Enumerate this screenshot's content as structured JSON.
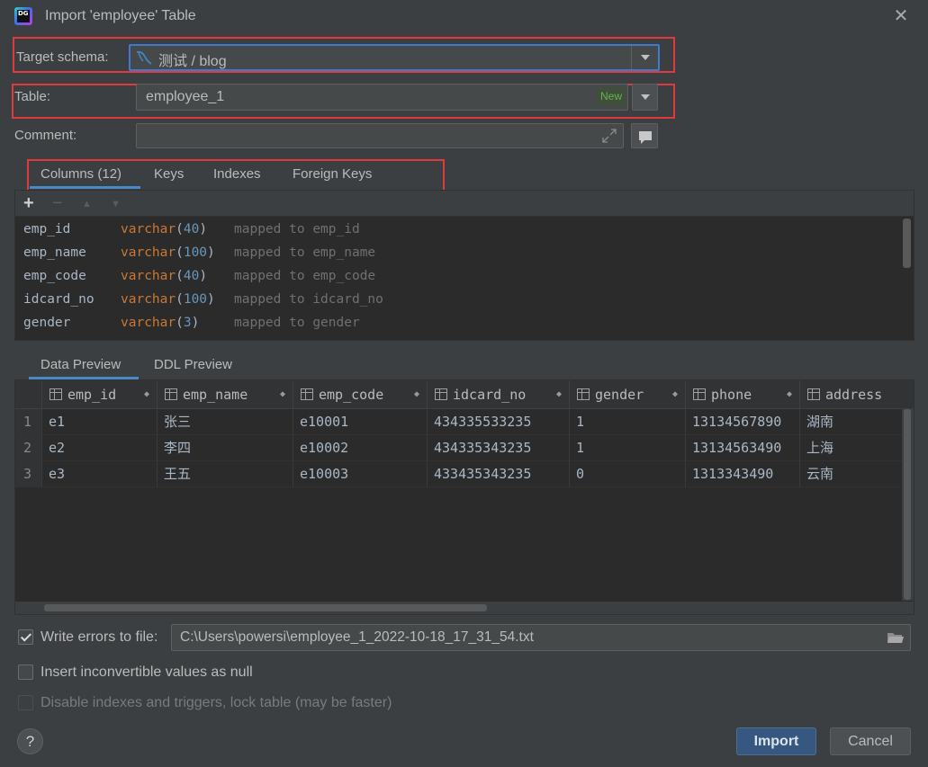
{
  "window": {
    "title": "Import 'employee' Table",
    "app_icon_text": "DG"
  },
  "form": {
    "target_schema_label": "Target schema:",
    "target_schema_value": "测试 / blog",
    "table_label": "Table:",
    "table_value": "employee_1",
    "table_badge": "New",
    "comment_label": "Comment:",
    "comment_value": ""
  },
  "tabs": [
    {
      "label": "Columns (12)",
      "active": true
    },
    {
      "label": "Keys",
      "active": false
    },
    {
      "label": "Indexes",
      "active": false
    },
    {
      "label": "Foreign Keys",
      "active": false
    }
  ],
  "toolbar": {
    "add": "+",
    "remove": "−",
    "up": "▲",
    "down": "▼"
  },
  "columns": [
    {
      "name": "emp_id",
      "type": "varchar",
      "size": "40",
      "mapped_prefix": "mapped to",
      "mapped_to": "emp_id"
    },
    {
      "name": "emp_name",
      "type": "varchar",
      "size": "100",
      "mapped_prefix": "mapped to",
      "mapped_to": "emp_name"
    },
    {
      "name": "emp_code",
      "type": "varchar",
      "size": "40",
      "mapped_prefix": "mapped to",
      "mapped_to": "emp_code"
    },
    {
      "name": "idcard_no",
      "type": "varchar",
      "size": "100",
      "mapped_prefix": "mapped to",
      "mapped_to": "idcard_no"
    },
    {
      "name": "gender",
      "type": "varchar",
      "size": "3",
      "mapped_prefix": "mapped to",
      "mapped_to": "gender"
    }
  ],
  "preview_tabs": [
    {
      "label": "Data Preview",
      "active": true
    },
    {
      "label": "DDL Preview",
      "active": false
    }
  ],
  "grid": {
    "headers": [
      "emp_id",
      "emp_name",
      "emp_code",
      "idcard_no",
      "gender",
      "phone",
      "address"
    ],
    "rows": [
      {
        "num": "1",
        "cells": [
          "e1",
          "张三",
          "e10001",
          "434335533235",
          "1",
          "13134567890",
          "湖南"
        ]
      },
      {
        "num": "2",
        "cells": [
          "e2",
          "李四",
          "e10002",
          "434335343235",
          "1",
          "13134563490",
          "上海"
        ]
      },
      {
        "num": "3",
        "cells": [
          "e3",
          "王五",
          "e10003",
          "433435343235",
          "0",
          "1313343490",
          "云南"
        ]
      }
    ]
  },
  "options": {
    "write_errors_label": "Write errors to file:",
    "write_errors_checked": true,
    "error_file_path": "C:\\Users\\powersi\\employee_1_2022-10-18_17_31_54.txt",
    "inconvertible_label": "Insert inconvertible values as null",
    "inconvertible_checked": false,
    "disable_indexes_label": "Disable indexes and triggers, lock table (may be faster)",
    "disable_indexes_checked": false
  },
  "footer": {
    "help": "?",
    "import": "Import",
    "cancel": "Cancel"
  },
  "colors": {
    "accent": "#4a88c7",
    "highlight_box": "#e03a3e",
    "type_keyword": "#cc7832",
    "number": "#6897bb"
  }
}
